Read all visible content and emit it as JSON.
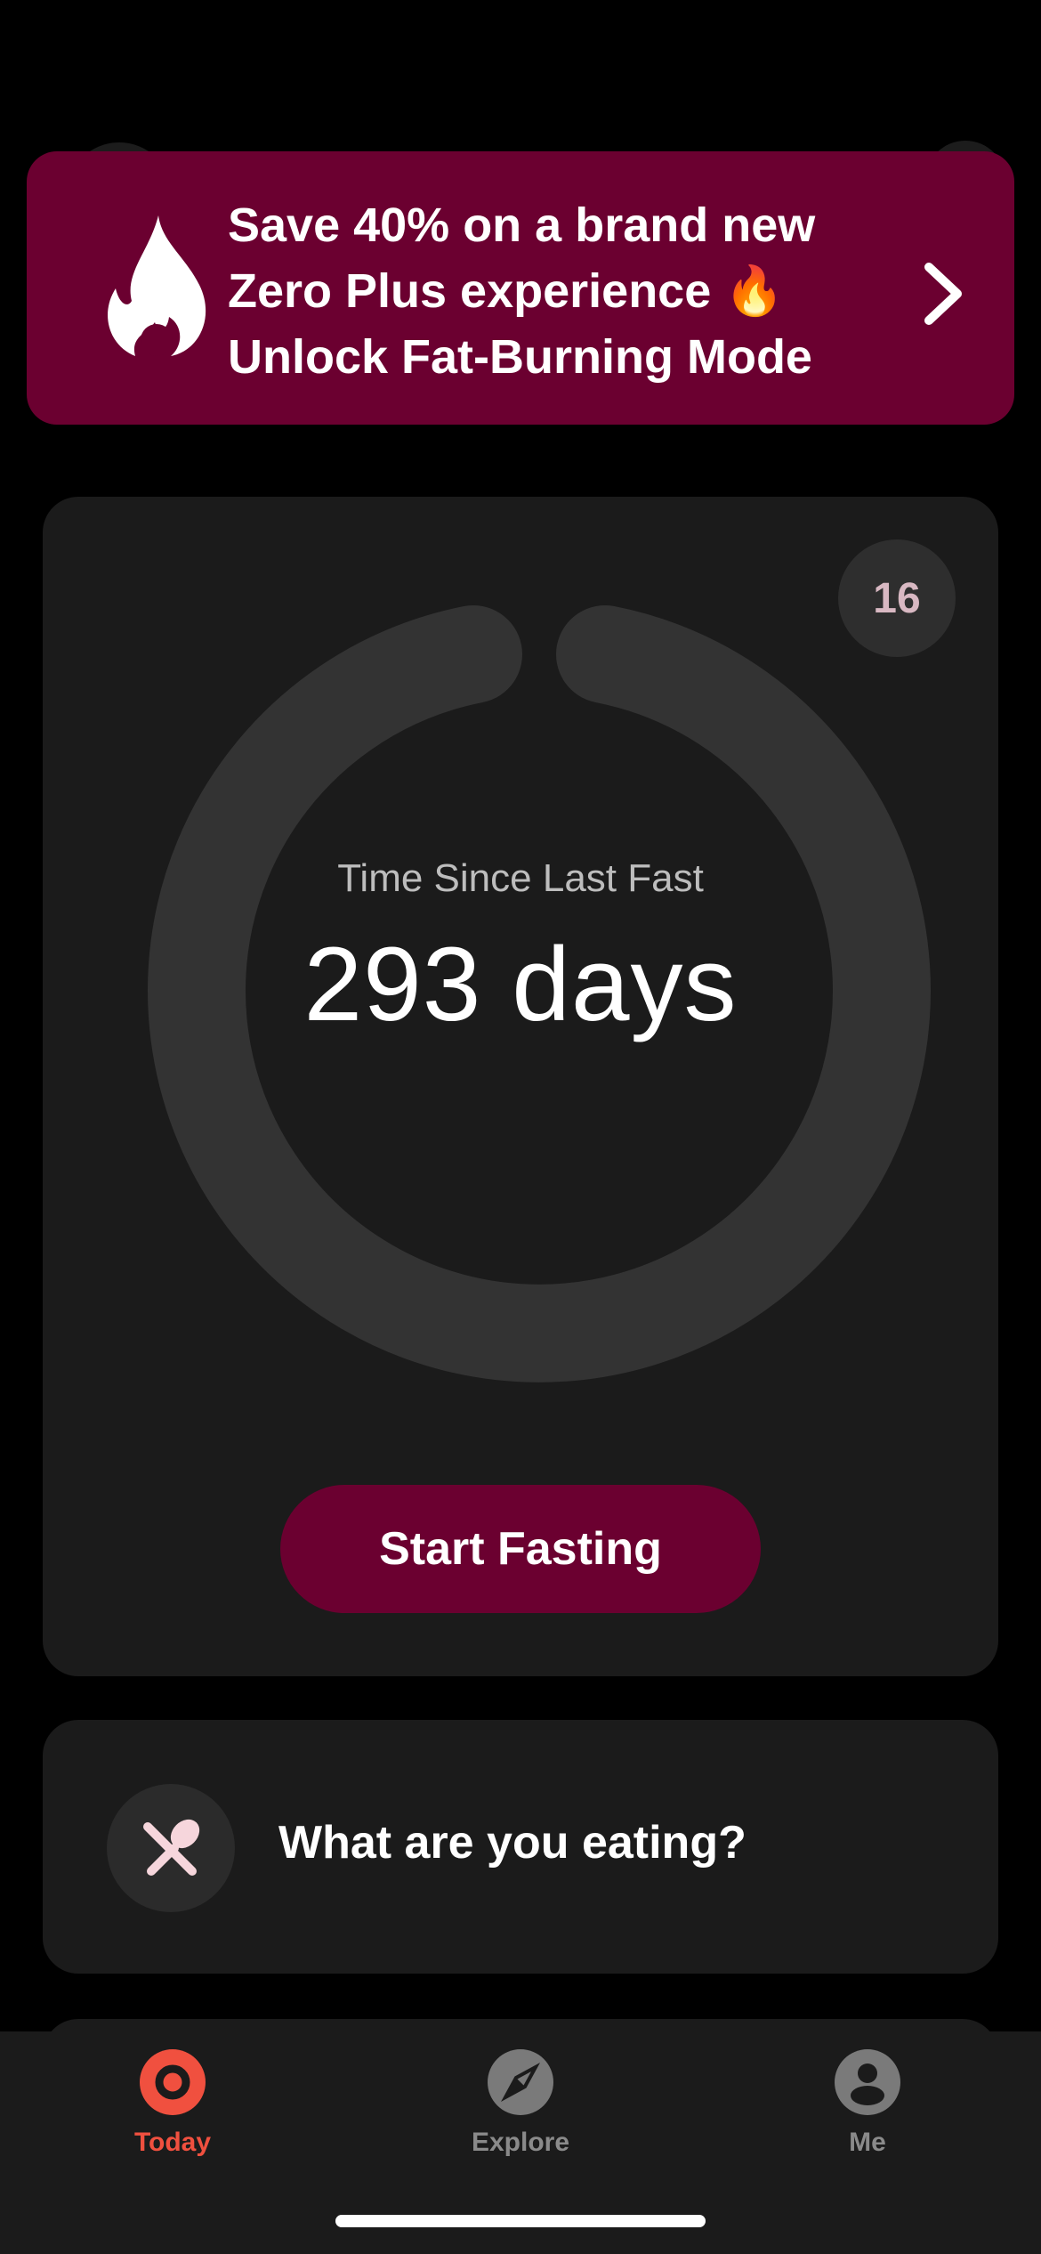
{
  "promo": {
    "line1": "Save 40% on a brand new",
    "line2": "Zero Plus experience 🔥",
    "line3": "Unlock Fat-Burning Mode",
    "bg_color": "#6b0030",
    "icons": {
      "left": "flame-icon",
      "right": "chevron-right-icon"
    }
  },
  "timer": {
    "badge": "16",
    "caption": "Time Since Last Fast",
    "value": "293 days",
    "start_button": "Start Fasting"
  },
  "eating": {
    "label": "What are you eating?",
    "icon": "fork-spoon-icon"
  },
  "tabbar": {
    "tabs": [
      {
        "label": "Today",
        "icon": "today-ring-icon",
        "active": true,
        "color": "#f0503f"
      },
      {
        "label": "Explore",
        "icon": "compass-icon",
        "active": false,
        "color": "#8a8a8a"
      },
      {
        "label": "Me",
        "icon": "profile-icon",
        "active": false,
        "color": "#8a8a8a"
      }
    ]
  }
}
